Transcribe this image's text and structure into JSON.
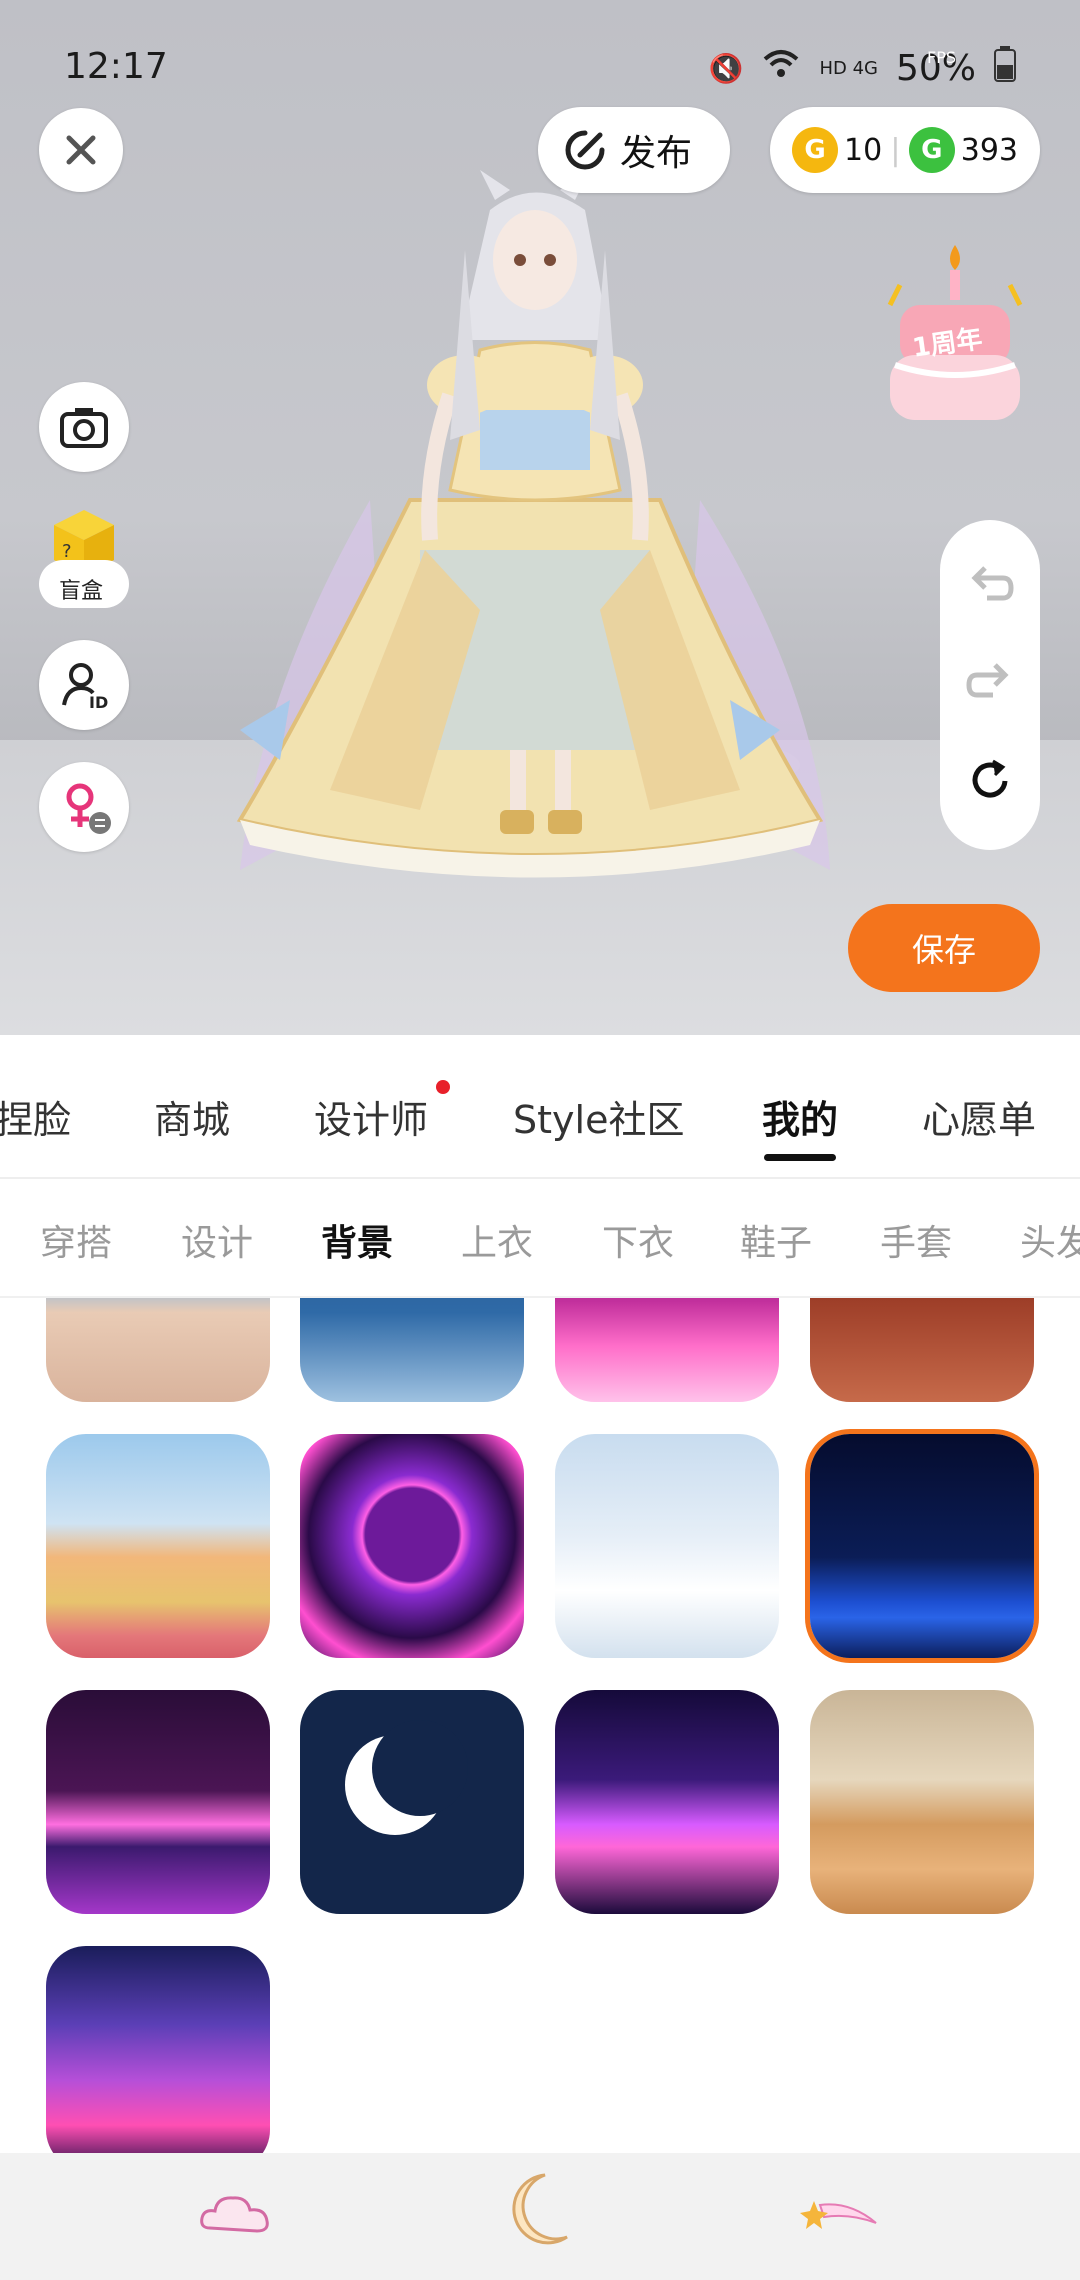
{
  "status_bar": {
    "time": "12:17",
    "network": "HD 4G",
    "battery": "50%",
    "fps": "FPS"
  },
  "top": {
    "publish_label": "发布",
    "coin_gold": "10",
    "coin_green": "393"
  },
  "left_tools": {
    "blind_box_label": "盲盒"
  },
  "badge": {
    "anniversary": "1周年"
  },
  "save_label": "保存",
  "main_tabs": [
    {
      "label": "捏脸"
    },
    {
      "label": "商城"
    },
    {
      "label": "设计师"
    },
    {
      "label": "Style社区"
    },
    {
      "label": "我的"
    },
    {
      "label": "心愿单"
    }
  ],
  "sub_tabs": [
    {
      "label": "穿搭"
    },
    {
      "label": "设计"
    },
    {
      "label": "背景"
    },
    {
      "label": "上衣"
    },
    {
      "label": "下衣"
    },
    {
      "label": "鞋子"
    },
    {
      "label": "手套"
    },
    {
      "label": "头发"
    }
  ],
  "colors": {
    "accent": "#f4741c",
    "notify_dot": "#e8202a",
    "coin_gold": "#f5b70f",
    "coin_green": "#3cc13f"
  },
  "backgrounds": [
    {
      "name": "school-plaza"
    },
    {
      "name": "blue-glass-hall"
    },
    {
      "name": "pink-stage"
    },
    {
      "name": "red-lantern-street"
    },
    {
      "name": "autumn-schoolyard"
    },
    {
      "name": "neon-portal"
    },
    {
      "name": "snowy-field"
    },
    {
      "name": "starry-blue-grid",
      "selected": true
    },
    {
      "name": "neon-triangle-purple"
    },
    {
      "name": "crescent-moon"
    },
    {
      "name": "neon-diamond"
    },
    {
      "name": "basketball-court"
    },
    {
      "name": "neon-cavern"
    }
  ],
  "bottom_nav": [
    {
      "icon": "cloud-icon"
    },
    {
      "icon": "moon-icon"
    },
    {
      "icon": "shooting-star-icon"
    }
  ]
}
